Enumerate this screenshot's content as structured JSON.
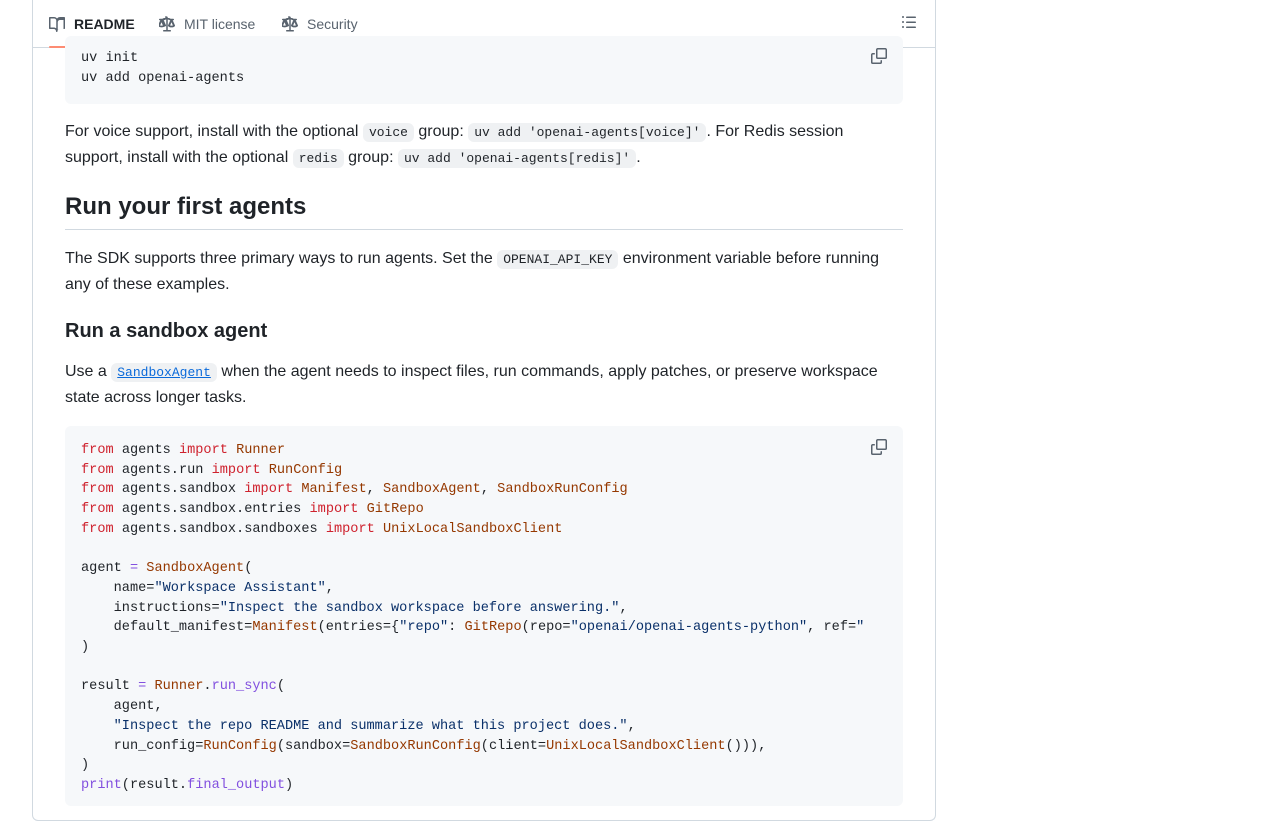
{
  "tabs": [
    {
      "label": "README",
      "icon": "book-icon"
    },
    {
      "label": "MIT license",
      "icon": "scale-icon"
    },
    {
      "label": "Security",
      "icon": "scale-icon"
    }
  ],
  "install_code": {
    "lines": [
      "uv init",
      "uv add openai-agents"
    ]
  },
  "voice_para": {
    "t1": "For voice support, install with the optional ",
    "c1": "voice",
    "t2": " group: ",
    "c2": "uv add 'openai-agents[voice]'",
    "t3": ". For Redis session support, install with the optional ",
    "c3": "redis",
    "t4": " group: ",
    "c4": "uv add 'openai-agents[redis]'",
    "t5": "."
  },
  "section_heading": "Run your first agents",
  "sdk_para": {
    "t1": "The SDK supports three primary ways to run agents. Set the ",
    "c1": "OPENAI_API_KEY",
    "t2": " environment variable before running any of these examples."
  },
  "sub_heading": "Run a sandbox agent",
  "sandbox_para": {
    "t1": "Use a ",
    "link": "SandboxAgent",
    "t2": " when the agent needs to inspect files, run commands, apply patches, or preserve workspace state across longer tasks."
  },
  "example_code": {
    "lines": [
      "from agents import Runner",
      "from agents.run import RunConfig",
      "from agents.sandbox import Manifest, SandboxAgent, SandboxRunConfig",
      "from agents.sandbox.entries import GitRepo",
      "from agents.sandbox.sandboxes import UnixLocalSandboxClient",
      "",
      "agent = SandboxAgent(",
      "    name=\"Workspace Assistant\",",
      "    instructions=\"Inspect the sandbox workspace before answering.\",",
      "    default_manifest=Manifest(entries={\"repo\": GitRepo(repo=\"openai/openai-agents-python\", ref=\"",
      ")",
      "",
      "result = Runner.run_sync(",
      "    agent,",
      "    \"Inspect the repo README and summarize what this project does.\",",
      "    run_config=RunConfig(sandbox=SandboxRunConfig(client=UnixLocalSandboxClient())),",
      ")",
      "print(result.final_output)"
    ]
  },
  "colors": {
    "keyword": "#cf222e",
    "name": "#953800",
    "function": "#8250df",
    "string": "#0a3069",
    "link": "#0969da",
    "tab_underline": "#fd8c73"
  }
}
